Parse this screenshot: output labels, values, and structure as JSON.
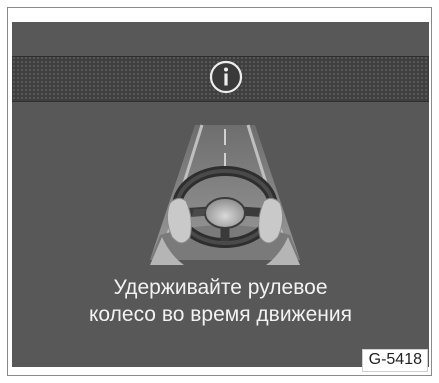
{
  "notice": {
    "icon": "info-icon",
    "message_line1": "Удерживайте рулевое",
    "message_line2": "колесо во время движения",
    "image_code": "G-5418"
  },
  "colors": {
    "screen_bg": "#585858",
    "band_bg": "#3f3f3f",
    "text": "#f2f2f2"
  }
}
